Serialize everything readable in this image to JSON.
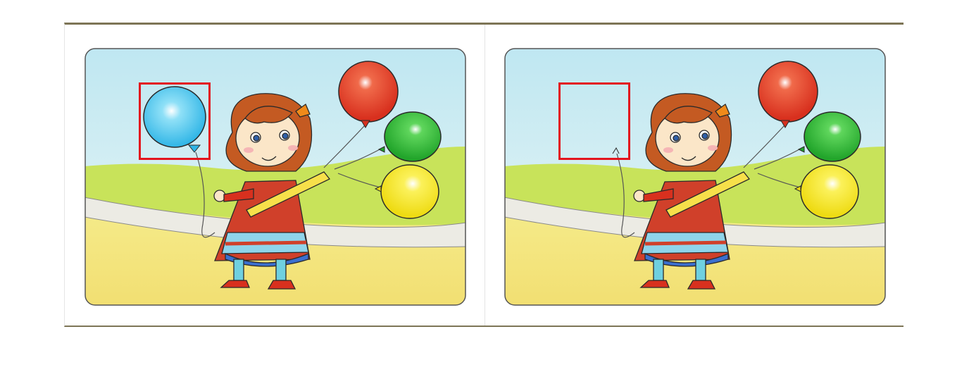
{
  "game": {
    "type": "spot-the-difference",
    "accent_color": "#e3151d",
    "frame_color": "#7d7556",
    "panels": [
      {
        "name": "original",
        "balloons": [
          "blue",
          "red",
          "green",
          "yellow"
        ],
        "difference_marked": true
      },
      {
        "name": "modified",
        "balloons": [
          "red",
          "green",
          "yellow"
        ],
        "difference_marked": true
      }
    ],
    "differences_marked": 1,
    "balloon_colors": {
      "blue": "#40c4ee",
      "red": "#e53a26",
      "green": "#2fb536",
      "yellow": "#f4e71c"
    }
  }
}
